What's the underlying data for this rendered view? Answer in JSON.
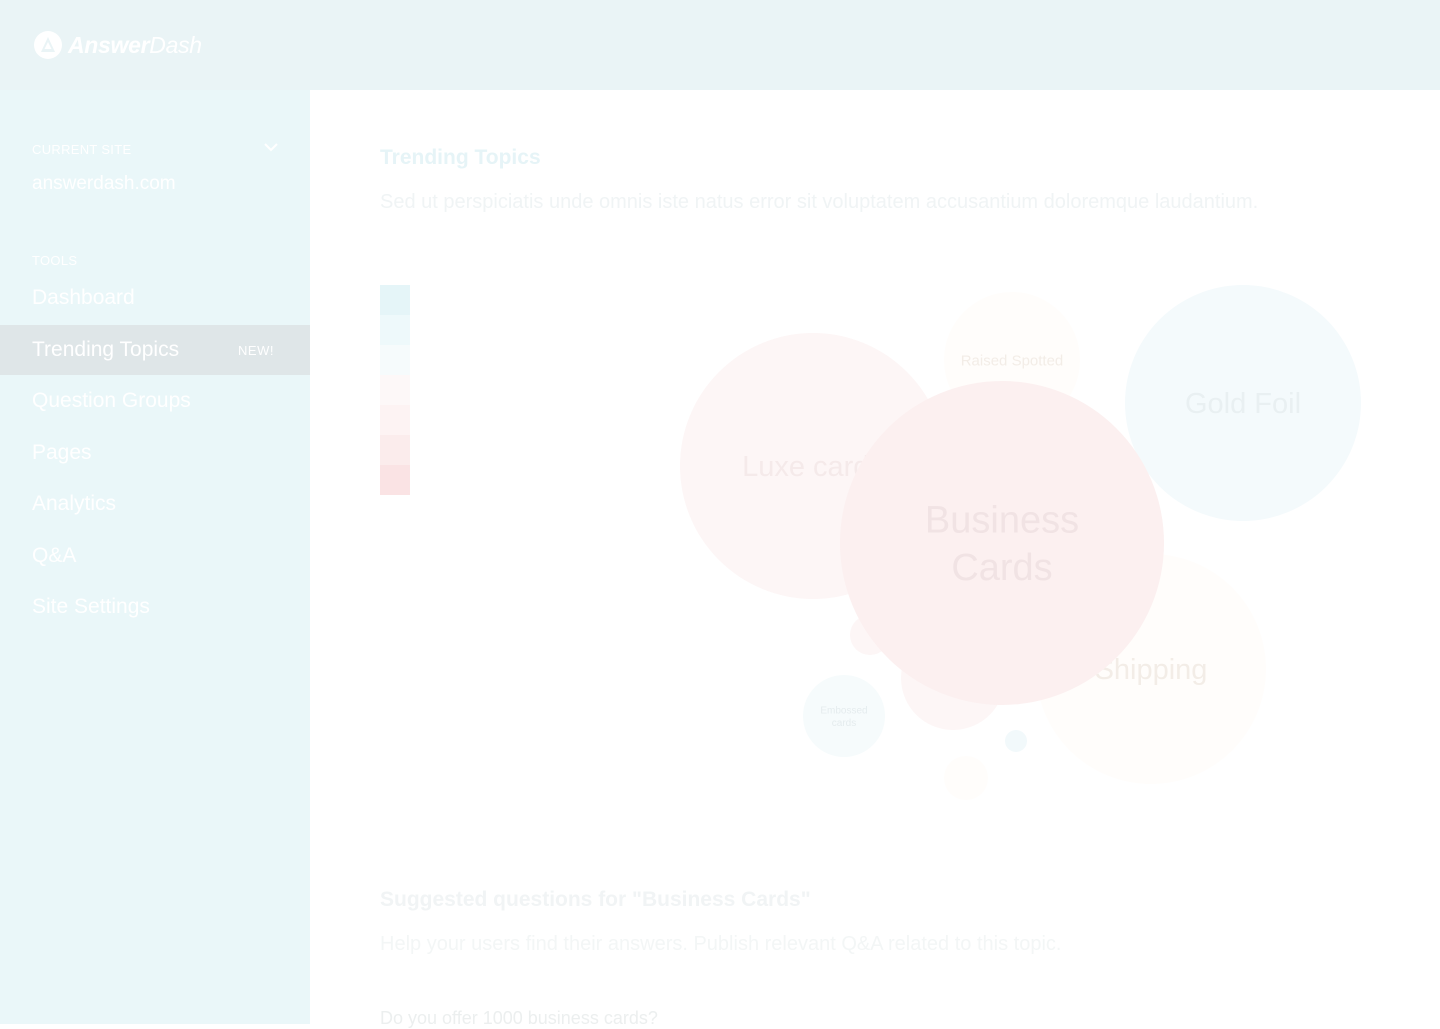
{
  "app": {
    "brand_bold": "Answer",
    "brand_light": "Dash"
  },
  "sidebar": {
    "current_site_label": "CURRENT SITE",
    "current_site_value": "answerdash.com",
    "tools_label": "TOOLS",
    "items": [
      {
        "label": "Dashboard"
      },
      {
        "label": "Trending Topics",
        "badge": "NEW!",
        "active": true
      },
      {
        "label": "Question Groups"
      },
      {
        "label": "Pages"
      },
      {
        "label": "Analytics"
      },
      {
        "label": "Q&A"
      },
      {
        "label": "Site Settings"
      }
    ]
  },
  "main": {
    "title": "Trending Topics",
    "description": "Sed ut perspiciatis unde omnis iste natus error sit voluptatem accusantium doloremque laudantium.",
    "legend_colors": [
      "#e5f5f8",
      "#eef9fb",
      "#f6fbfc",
      "#fdf8f8",
      "#fdf3f3",
      "#fbecec",
      "#fae3e4"
    ],
    "suggest_title": "Suggested questions for \"Business Cards\"",
    "suggest_description": "Help your users find their answers. Publish relevant Q&A related to this topic.",
    "questions": [
      {
        "text": "Do you offer 1000 business cards?"
      }
    ]
  },
  "chart_data": {
    "type": "bubble",
    "bubbles": [
      {
        "label": "Luxe cards",
        "color": "#fdf6f6",
        "text_color": "#f5eaea"
      },
      {
        "label": "Raised Spotted",
        "color": "#fffdfb",
        "text_color": "#f3ede7"
      },
      {
        "label": "Gold Foil",
        "color": "#f4fafc",
        "text_color": "#e9f0f2"
      },
      {
        "label": "Shipping",
        "color": "#fffdfb",
        "text_color": "#f3ede7"
      },
      {
        "label": "",
        "color": "#fdf6f6",
        "text_color": ""
      },
      {
        "label": "",
        "color": "#fdf6f6",
        "text_color": ""
      },
      {
        "label": "Embossed cards",
        "color": "#f6fbfc",
        "text_color": "#e5ecee"
      },
      {
        "label": "",
        "color": "#f2f9fb",
        "text_color": ""
      },
      {
        "label": "",
        "color": "#fffdfb",
        "text_color": ""
      },
      {
        "label": "Business Cards",
        "label_lines": [
          "Business",
          "Cards"
        ],
        "color": "#fcf0f0",
        "text_color": "#f1e3e4"
      }
    ]
  }
}
